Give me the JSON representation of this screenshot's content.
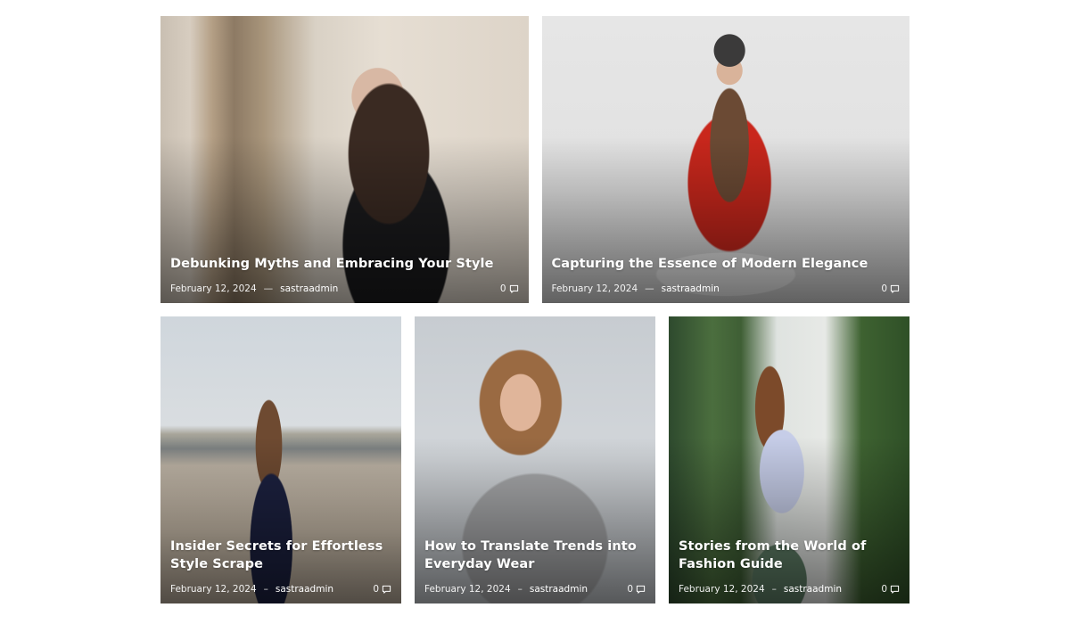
{
  "posts": [
    {
      "title": "Debunking Myths and Embracing Your Style",
      "date": "February 12, 2024",
      "separator": "—",
      "author": "sastraadmin",
      "comments": "0",
      "photo": "woman-dark-hair-black-top-stone-wall"
    },
    {
      "title": "Capturing the Essence of Modern Elegance",
      "date": "February 12, 2024",
      "separator": "—",
      "author": "sastraadmin",
      "comments": "0",
      "photo": "woman-red-coat-grey-beanie"
    },
    {
      "title": "Insider Secrets for Effortless Style Scrape",
      "date": "February 12, 2024",
      "separator": "–",
      "author": "sastraadmin",
      "comments": "0",
      "photo": "woman-navy-dress-beach"
    },
    {
      "title": "How to Translate Trends into Everyday Wear",
      "date": "February 12, 2024",
      "separator": "–",
      "author": "sastraadmin",
      "comments": "0",
      "photo": "woman-grey-sweater-smiling"
    },
    {
      "title": "Stories from the World of Fashion Guide",
      "date": "February 12, 2024",
      "separator": "–",
      "author": "sastraadmin",
      "comments": "0",
      "photo": "woman-lavender-blouse-garden"
    }
  ],
  "icons": {
    "comment": "comment-icon"
  },
  "colors": {
    "text": "#ffffff",
    "background": "#ffffff"
  }
}
